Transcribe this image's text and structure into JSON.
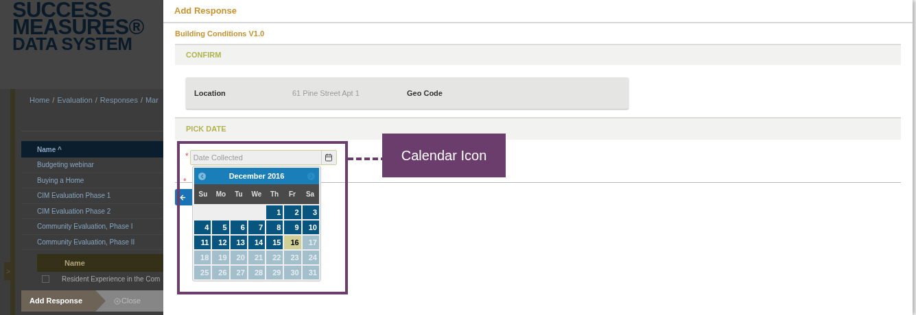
{
  "background_page": {
    "logo": [
      "SUCCESS",
      "MEASURES®",
      "DATA SYSTEM"
    ],
    "breadcrumbs": [
      "Home",
      "Evaluation",
      "Responses",
      "Mar"
    ],
    "breadcrumb_separator": "/",
    "table": {
      "header": "Name ^",
      "rows": [
        "Budgeting webinar",
        "Buying a Home",
        "CIM Evaluation Phase 1",
        "CIM Evaluation Phase 2",
        "Community Evaluation, Phase I",
        "Community Evaluation, Phase II"
      ],
      "subtable": {
        "header": "Name",
        "rows": [
          {
            "label": "Resident Experience in the Com",
            "checked": false
          }
        ]
      }
    },
    "sidebar_toggle": ">",
    "bottom_bar": {
      "title": "Add Response",
      "close": "Close"
    }
  },
  "modal": {
    "title": "Add Response",
    "survey": "Building Conditions V1.0",
    "sections": [
      {
        "title": "CONFIRM"
      },
      {
        "title": "PICK DATE"
      }
    ],
    "location": {
      "label": "Location",
      "value": "61 Pine Street Apt 1",
      "geo_label": "Geo Code"
    },
    "date_field": {
      "placeholder": "Date Collected",
      "required_mark": "*"
    },
    "second_field": {
      "required_mark": "*"
    },
    "datepicker": {
      "month": "December 2016",
      "prev_enabled": true,
      "next_enabled": false,
      "weekdays": [
        "Su",
        "Mo",
        "Tu",
        "We",
        "Th",
        "Fr",
        "Sa"
      ],
      "weeks": [
        [
          {
            "day": "1",
            "kind": "available"
          },
          {
            "day": "2",
            "kind": "available"
          },
          {
            "day": "3",
            "kind": "available"
          }
        ],
        [
          {
            "day": "4",
            "kind": "available"
          },
          {
            "day": "5",
            "kind": "available"
          },
          {
            "day": "6",
            "kind": "available"
          },
          {
            "day": "7",
            "kind": "available"
          },
          {
            "day": "8",
            "kind": "available"
          },
          {
            "day": "9",
            "kind": "available"
          },
          {
            "day": "10",
            "kind": "available"
          }
        ],
        [
          {
            "day": "11",
            "kind": "available"
          },
          {
            "day": "12",
            "kind": "available"
          },
          {
            "day": "13",
            "kind": "available"
          },
          {
            "day": "14",
            "kind": "available"
          },
          {
            "day": "15",
            "kind": "available"
          },
          {
            "day": "16",
            "kind": "today"
          },
          {
            "day": "17",
            "kind": "disabled"
          }
        ],
        [
          {
            "day": "18",
            "kind": "disabled"
          },
          {
            "day": "19",
            "kind": "disabled"
          },
          {
            "day": "20",
            "kind": "disabled"
          },
          {
            "day": "21",
            "kind": "disabled"
          },
          {
            "day": "22",
            "kind": "disabled"
          },
          {
            "day": "23",
            "kind": "disabled"
          },
          {
            "day": "24",
            "kind": "disabled"
          }
        ],
        [
          {
            "day": "25",
            "kind": "disabled"
          },
          {
            "day": "26",
            "kind": "disabled"
          },
          {
            "day": "27",
            "kind": "disabled"
          },
          {
            "day": "28",
            "kind": "disabled"
          },
          {
            "day": "29",
            "kind": "disabled"
          },
          {
            "day": "30",
            "kind": "disabled"
          },
          {
            "day": "31",
            "kind": "disabled"
          }
        ]
      ]
    }
  },
  "annotation": {
    "label": "Calendar Icon"
  }
}
